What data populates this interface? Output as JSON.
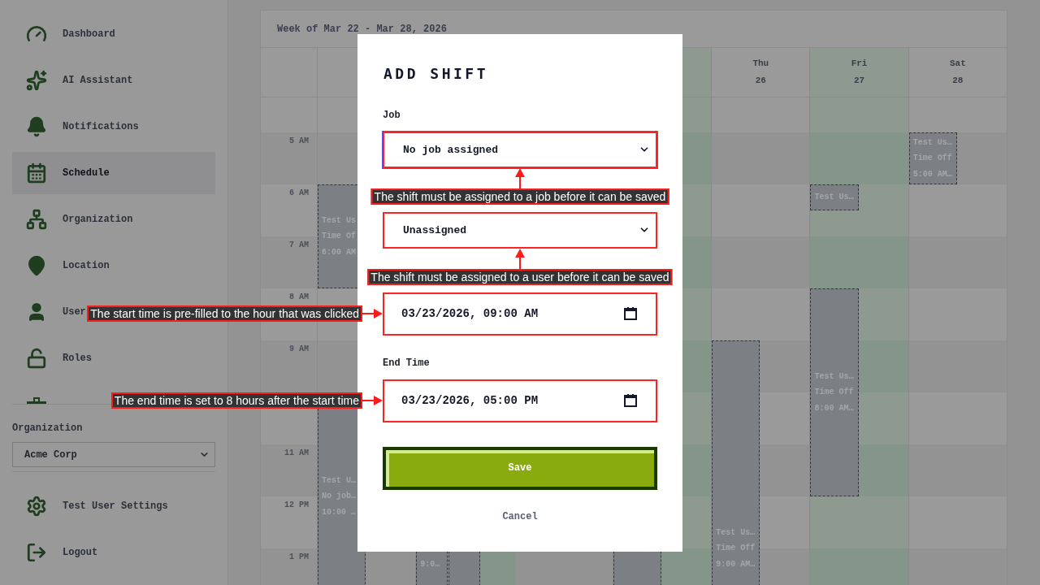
{
  "sidebar": {
    "items": [
      {
        "label": "Dashboard",
        "selected": false
      },
      {
        "label": "AI Assistant",
        "selected": false
      },
      {
        "label": "Notifications",
        "selected": false
      },
      {
        "label": "Schedule",
        "selected": true
      },
      {
        "label": "Organization",
        "selected": false
      },
      {
        "label": "Location",
        "selected": false
      },
      {
        "label": "User",
        "selected": false
      },
      {
        "label": "Roles",
        "selected": false
      }
    ],
    "organization": {
      "label": "Organization",
      "value": "Acme Corp"
    },
    "footer_items": [
      {
        "label": "Test User Settings"
      },
      {
        "label": "Logout"
      }
    ]
  },
  "calendar": {
    "title": "Week of Mar 22 - Mar 28, 2026",
    "day_headers": [
      {
        "weekday": "Thu",
        "date": "26"
      },
      {
        "weekday": "Fri",
        "date": "27"
      },
      {
        "weekday": "Sat",
        "date": "28"
      }
    ],
    "time_labels": [
      "5 AM",
      "6 AM",
      "7 AM",
      "8 AM",
      "9 AM",
      "11 AM",
      "12 PM",
      "1 PM"
    ],
    "shifts": [
      {
        "lines": [
          "Test Us",
          "Time Of",
          "6:00 AM"
        ]
      },
      {
        "lines": [
          "Test U…",
          "No job…",
          "10:00 …"
        ]
      },
      {
        "lines": [
          "9:0…"
        ]
      },
      {
        "lines": [
          "Test Us…",
          "Time Off",
          "9:00 AM…"
        ]
      },
      {
        "lines": [
          "Test Us…"
        ]
      },
      {
        "lines": [
          "Test Us…",
          "Time Off",
          "8:00 AM…"
        ]
      },
      {
        "lines": [
          "Test Us…",
          "Time Off",
          "5:00 AM…"
        ]
      }
    ]
  },
  "modal": {
    "title": "ADD SHIFT",
    "fields": [
      {
        "label": "Job",
        "kind": "select",
        "value": "No job assigned",
        "focused": true,
        "highlighted": true,
        "annotation": {
          "text": "The shift must be assigned to a job before it can be saved",
          "kind": "below"
        }
      },
      {
        "kind": "select",
        "value": "Unassigned",
        "focused": false,
        "highlighted": true,
        "annotation": {
          "text": "The shift must be assigned to a user before it can be saved",
          "kind": "below"
        }
      },
      {
        "kind": "datetime",
        "value": "03/23/2026, 09:00 AM",
        "focused": false,
        "highlighted": true,
        "annotation": {
          "text": "The start time is pre-filled to the hour that was clicked",
          "kind": "left"
        }
      },
      {
        "label": "End Time",
        "kind": "datetime",
        "value": "03/23/2026, 05:00 PM",
        "focused": false,
        "highlighted": true,
        "annotation": {
          "text": "The end time is set to 8 hours after the start time",
          "kind": "left"
        }
      }
    ],
    "save_button": "Save",
    "cancel_button": "Cancel"
  }
}
